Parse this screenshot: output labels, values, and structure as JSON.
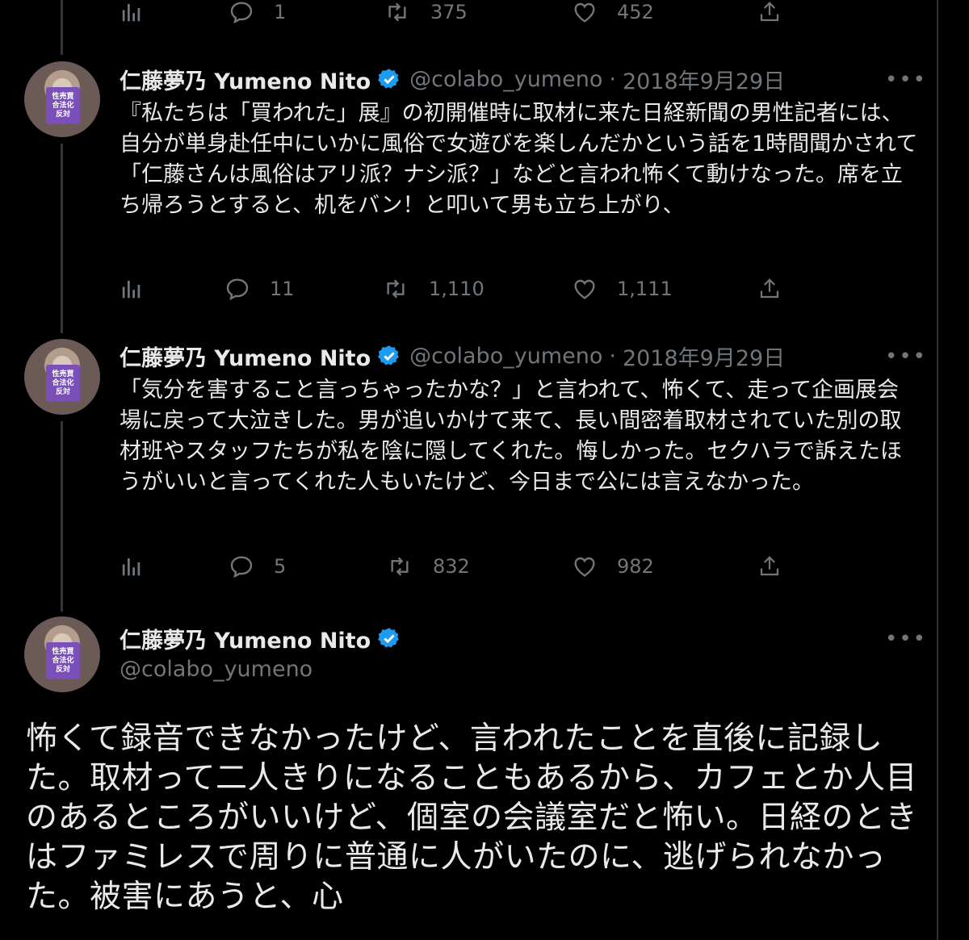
{
  "author": {
    "name": "仁藤夢乃 Yumeno Nito",
    "handle": "@colabo_yumeno",
    "avatar_sign": [
      "性売買",
      "合法化",
      "反対"
    ]
  },
  "top_actions": {
    "replies": "1",
    "retweets": "375",
    "likes": "452"
  },
  "tweets": [
    {
      "date": "2018年9月29日",
      "text": "『私たちは「買われた」展』の初開催時に取材に来た日経新聞の男性記者には、自分が単身赴任中にいかに風俗で女遊びを楽しんだかという話を1時間聞かされて「仁藤さんは風俗はアリ派？ナシ派？」などと言われ怖くて動けなった。席を立ち帰ろうとすると、机をバン！と叩いて男も立ち上がり、",
      "replies": "11",
      "retweets": "1,110",
      "likes": "1,111"
    },
    {
      "date": "2018年9月29日",
      "text": "「気分を害すること言っちゃったかな？」と言われて、怖くて、走って企画展会場に戻って大泣きした。男が追いかけて来て、長い間密着取材されていた別の取材班やスタッフたちが私を陰に隠してくれた。悔しかった。セクハラで訴えたほうがいいと言ってくれた人もいたけど、今日まで公には言えなかった。",
      "replies": "5",
      "retweets": "832",
      "likes": "982"
    }
  ],
  "main_tweet": {
    "text": "怖くて録音できなかったけど、言われたことを直後に記録した。取材って二人きりになることもあるから、カフェとか人目のあるところがいいけど、個室の会議室だと怖い。日経のときはファミレスで周りに普通に人がいたのに、逃げられなかった。被害にあうと、心"
  },
  "separator": "·",
  "more_glyph": "•••",
  "colors": {
    "background": "#000000",
    "text": "#e7e9ea",
    "secondary": "#71767b",
    "verified": "#1d9bf0",
    "thread_line": "#333639"
  }
}
